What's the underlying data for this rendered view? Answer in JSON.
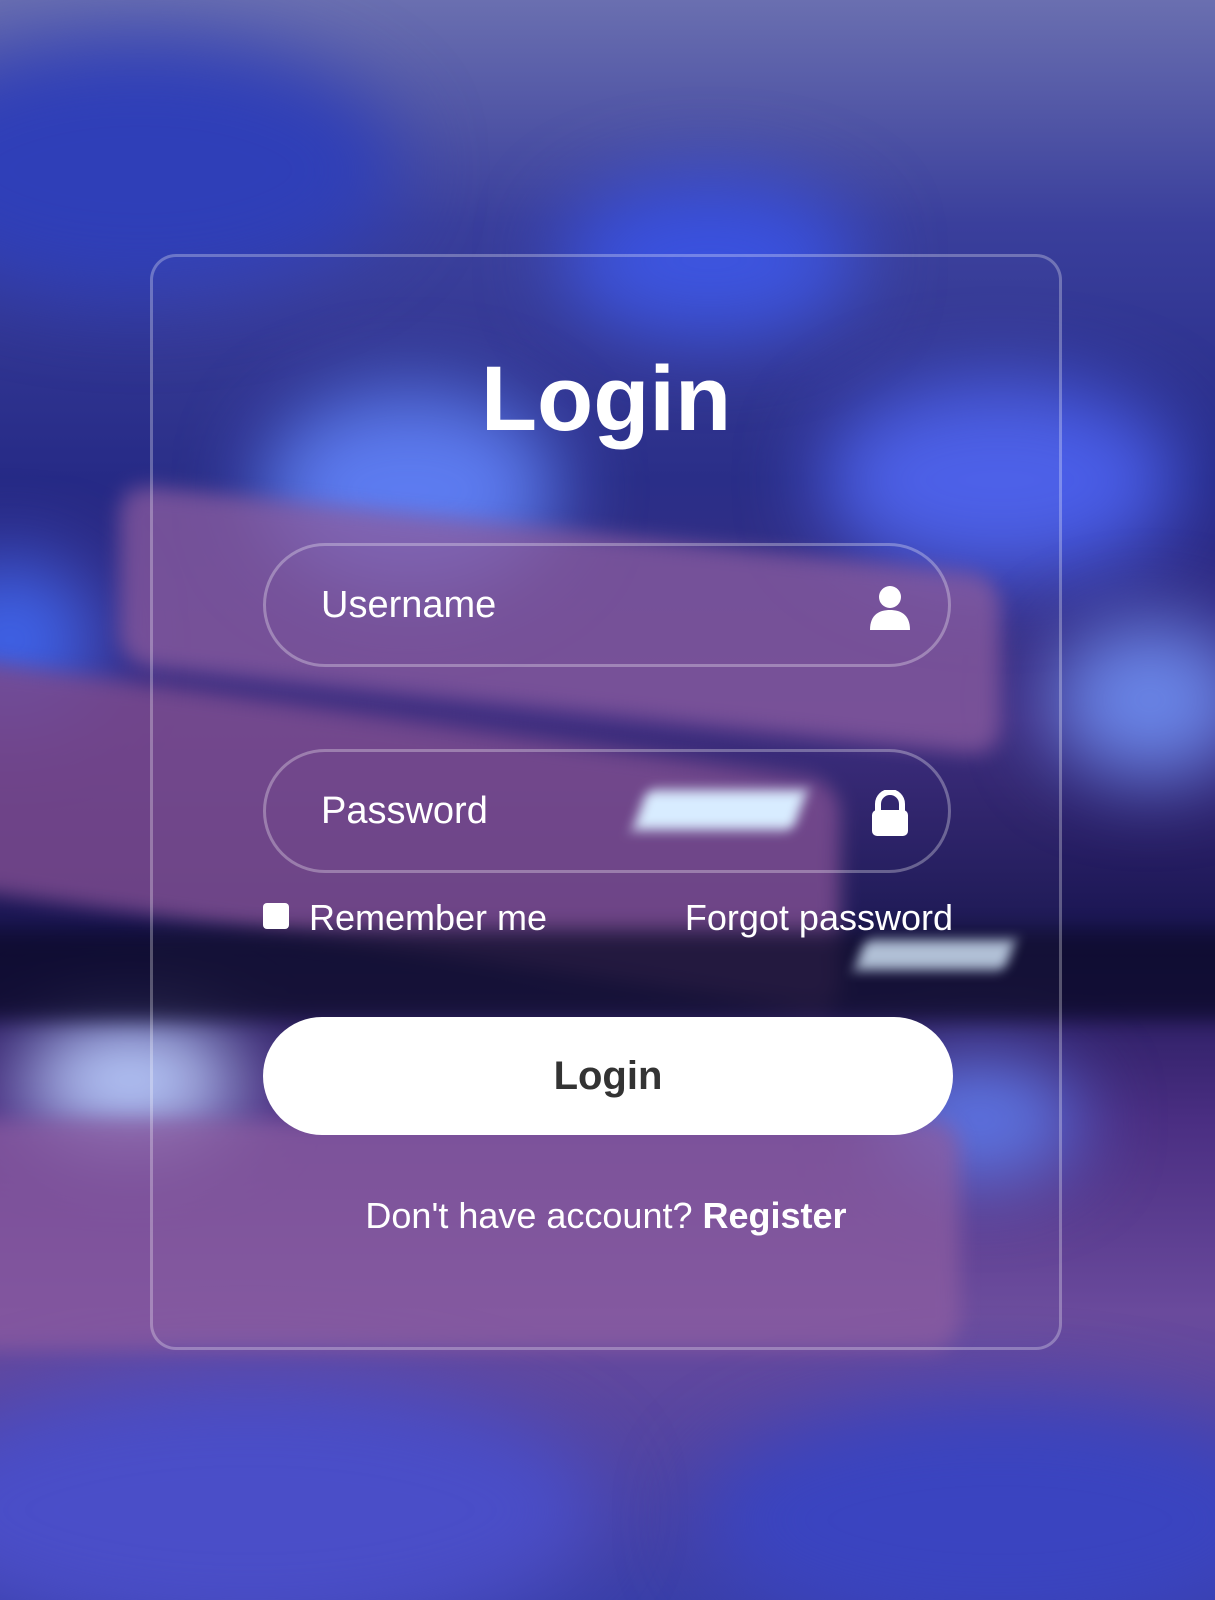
{
  "form": {
    "title": "Login",
    "username_placeholder": "Username",
    "password_placeholder": "Password",
    "remember_label": "Remember me",
    "remember_checked": false,
    "forgot_label": "Forgot password",
    "submit_label": "Login",
    "register_prompt": "Don't have account?",
    "register_link": "Register"
  },
  "icons": {
    "username": "user-icon",
    "password": "lock-icon"
  },
  "colors": {
    "text": "#ffffff",
    "button_bg": "#ffffff",
    "button_text": "#333333"
  }
}
